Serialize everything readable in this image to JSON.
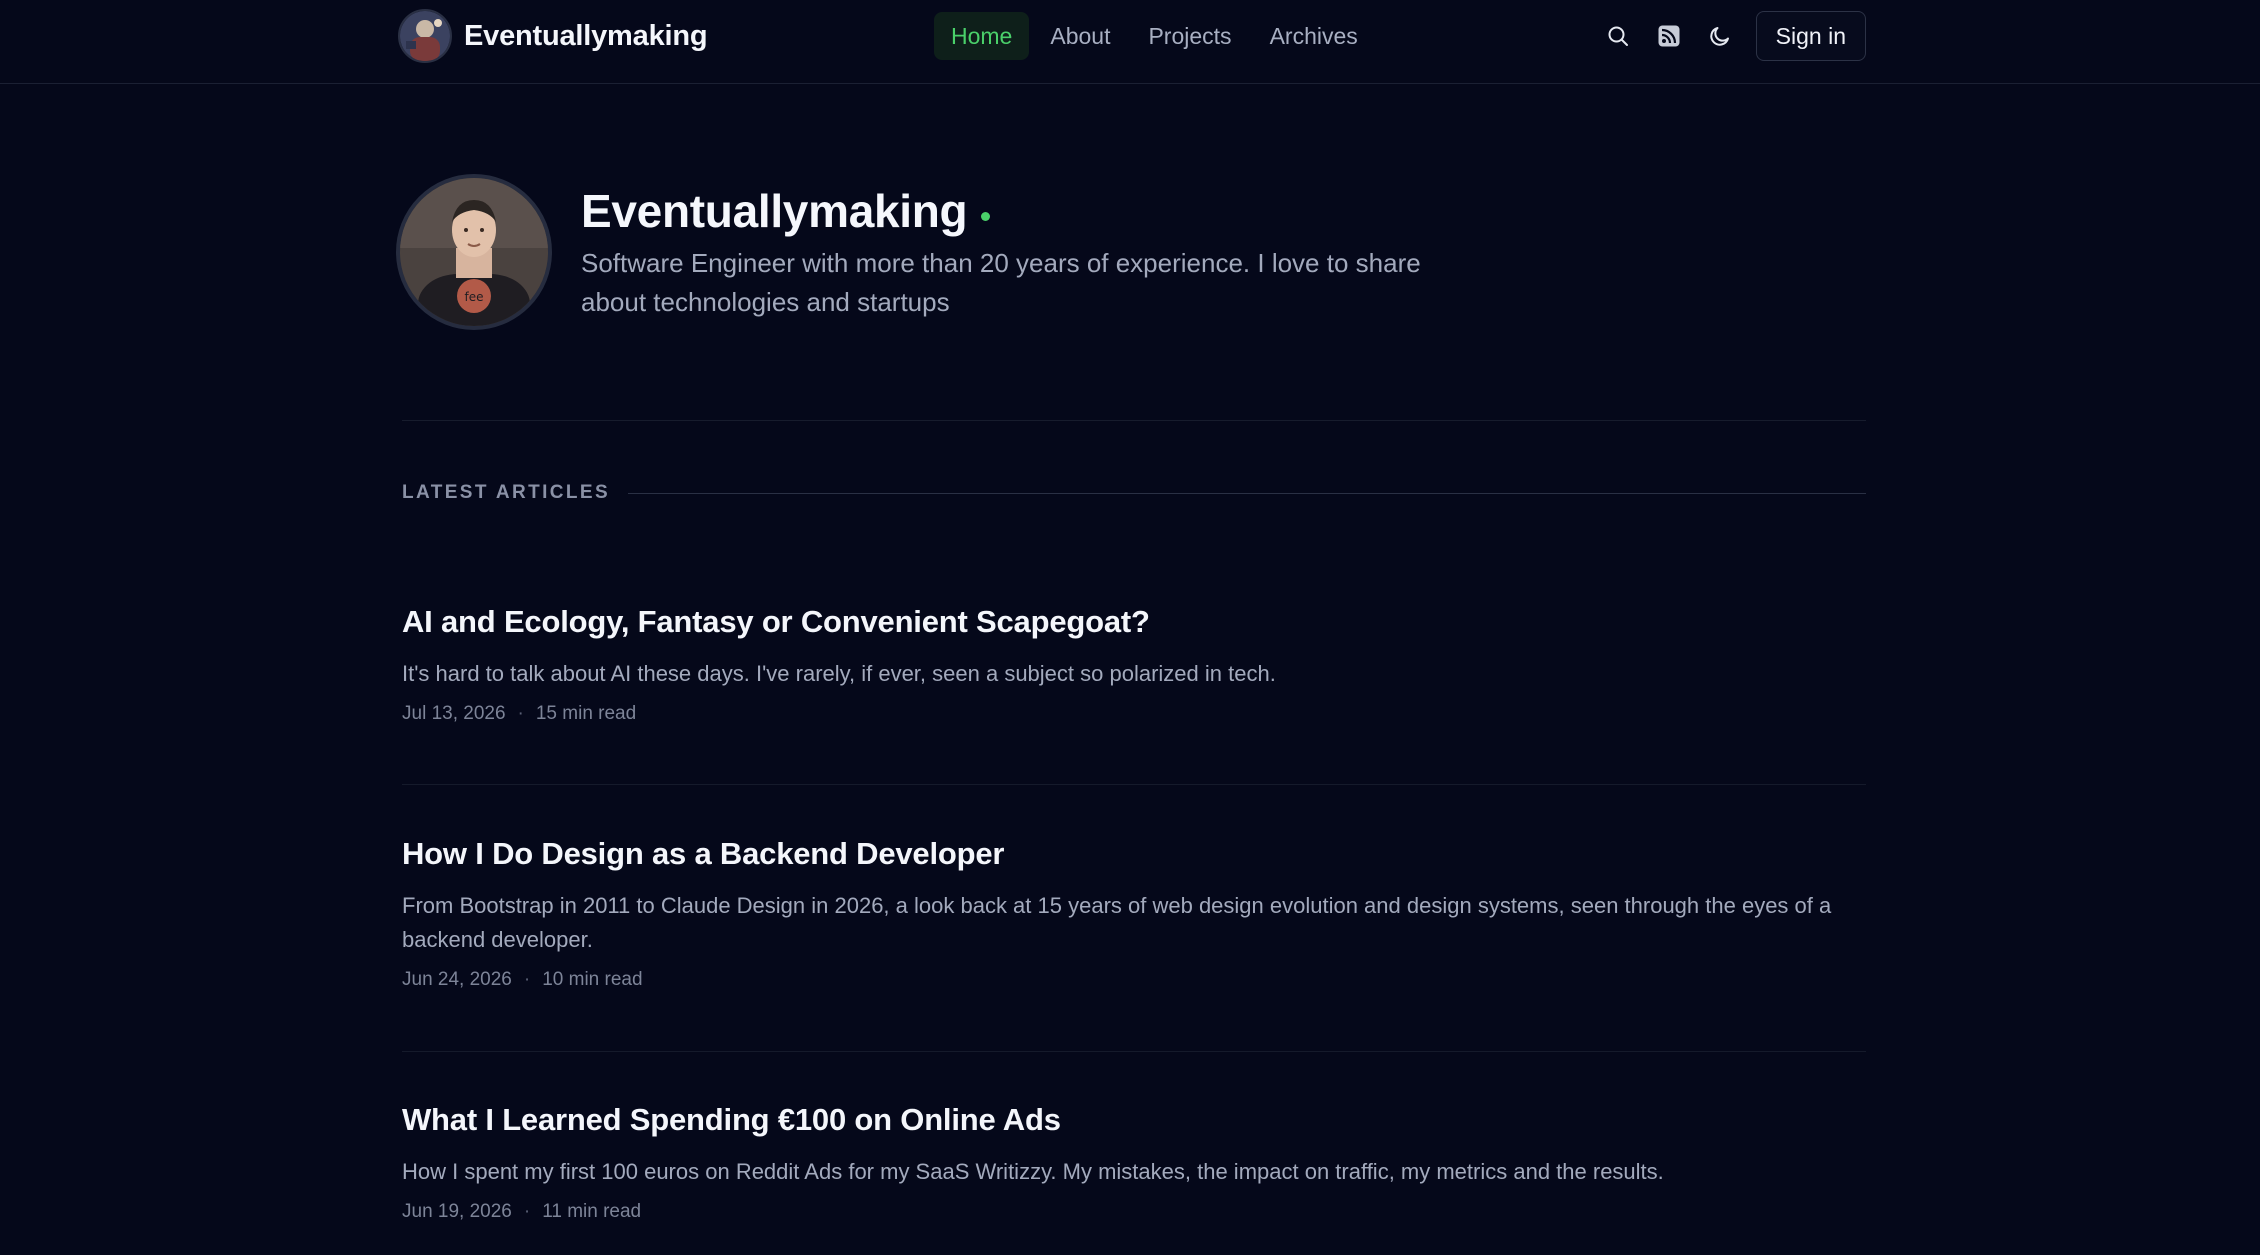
{
  "header": {
    "brand_name": "Eventuallymaking",
    "nav": [
      {
        "label": "Home",
        "active": true
      },
      {
        "label": "About",
        "active": false
      },
      {
        "label": "Projects",
        "active": false
      },
      {
        "label": "Archives",
        "active": false
      }
    ],
    "icons": [
      "search-icon",
      "rss-icon",
      "moon-icon"
    ],
    "signin_label": "Sign in"
  },
  "profile": {
    "name": "Eventuallymaking",
    "bio": "Software Engineer with more than 20 years of experience. I love to share about technologies and startups",
    "status_color": "#4ad06a"
  },
  "latest": {
    "section_title": "LATEST ARTICLES",
    "articles": [
      {
        "title": "AI and Ecology, Fantasy or Convenient Scapegoat?",
        "summary": "It's hard to talk about AI these days. I've rarely, if ever, seen a subject so polarized in tech.",
        "date": "Jul 13, 2026",
        "read_time": "15 min read"
      },
      {
        "title": "How I Do Design as a Backend Developer",
        "summary": "From Bootstrap in 2011 to Claude Design in 2026, a look back at 15 years of web design evolution and design systems, seen through the eyes of a backend developer.",
        "date": "Jun 24, 2026",
        "read_time": "10 min read"
      },
      {
        "title": "What I Learned Spending €100 on Online Ads",
        "summary": "How I spent my first 100 euros on Reddit Ads for my SaaS Writizzy. My mistakes, the impact on traffic, my metrics and the results.",
        "date": "Jun 19, 2026",
        "read_time": "11 min read"
      }
    ]
  },
  "colors": {
    "background": "#05081a",
    "accent": "#4ad06a",
    "text_primary": "#f4f6fb",
    "text_secondary": "#a3aabd"
  }
}
